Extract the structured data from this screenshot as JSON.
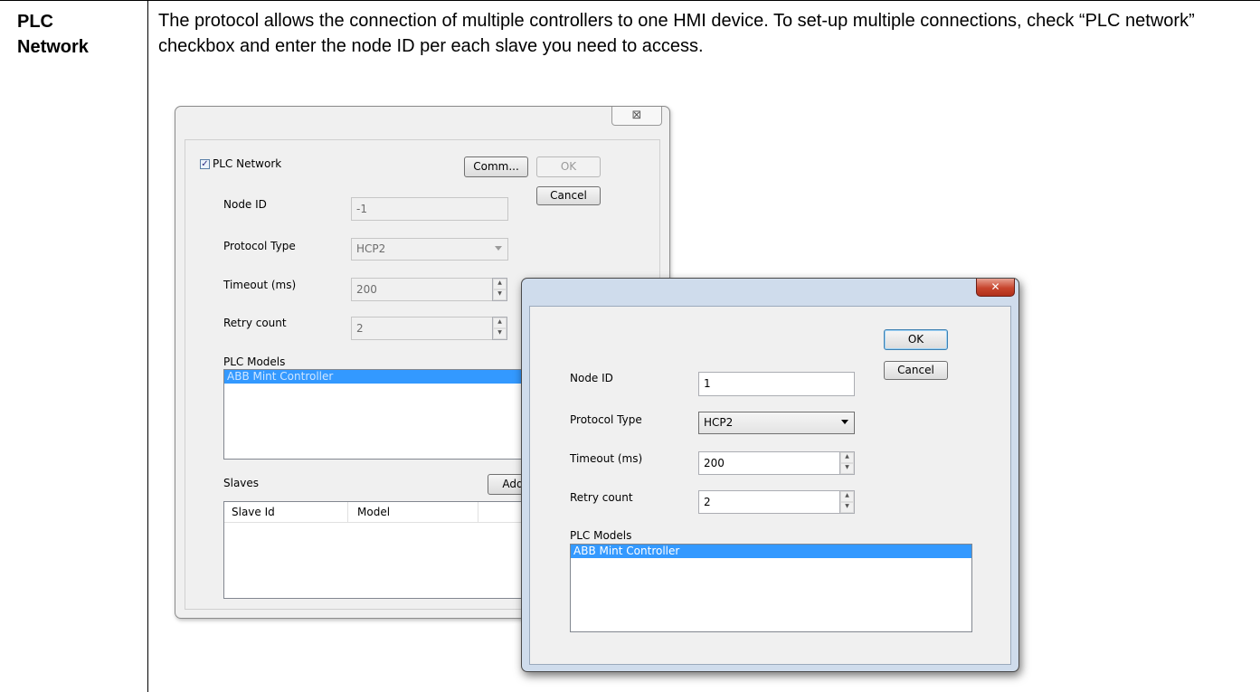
{
  "doc": {
    "term_line1": "PLC",
    "term_line2": "Network",
    "description": "The protocol allows the connection of multiple controllers to one HMI device. To set-up multiple connections, check “PLC network” checkbox and enter the node ID per each slave you need to access."
  },
  "back_dialog": {
    "close_glyph": "⊠",
    "plc_network_checkbox": {
      "label": "PLC Network",
      "checked": true,
      "check_glyph": "✓"
    },
    "comm_button": "Comm...",
    "ok_button": "OK",
    "cancel_button": "Cancel",
    "node_id": {
      "label": "Node ID",
      "value": "-1"
    },
    "protocol_type": {
      "label": "Protocol Type",
      "value": "HCP2"
    },
    "timeout": {
      "label": "Timeout (ms)",
      "value": "200"
    },
    "retry_count": {
      "label": "Retry count",
      "value": "2"
    },
    "plc_models": {
      "label": "PLC Models",
      "items": [
        "ABB Mint Controller"
      ]
    },
    "slaves": {
      "label": "Slaves",
      "add_button": "Add",
      "columns": [
        "Slave Id",
        "Model"
      ]
    }
  },
  "front_dialog": {
    "close_glyph": "✕",
    "ok_button": "OK",
    "cancel_button": "Cancel",
    "node_id": {
      "label": "Node ID",
      "value": "1"
    },
    "protocol_type": {
      "label": "Protocol Type",
      "value": "HCP2"
    },
    "timeout": {
      "label": "Timeout (ms)",
      "value": "200"
    },
    "retry_count": {
      "label": "Retry count",
      "value": "2"
    },
    "plc_models": {
      "label": "PLC Models",
      "items": [
        "ABB Mint Controller"
      ]
    }
  },
  "colors": {
    "selection": "#3399ff",
    "close_button_red": "#c7452d",
    "front_frame": "#cfdcec"
  }
}
